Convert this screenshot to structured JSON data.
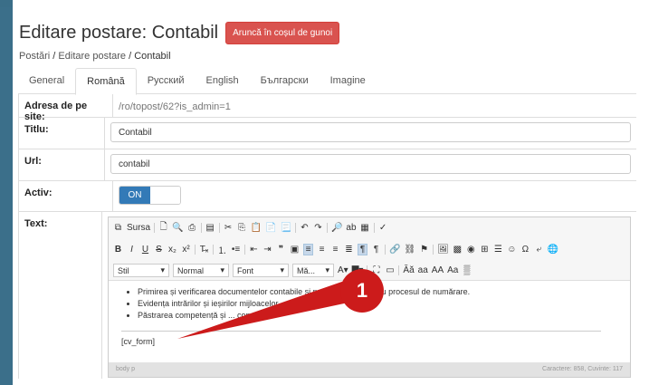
{
  "header": {
    "title": "Editare postare: Contabil",
    "trash_label": "Aruncă în coșul de gunoi"
  },
  "breadcrumb": {
    "root": "Postări",
    "sep1": " / ",
    "mid": "Editare postare",
    "sep2": " / ",
    "current": "Contabil"
  },
  "tabs": [
    "General",
    "Română",
    "Русский",
    "English",
    "Български",
    "Imagine"
  ],
  "form": {
    "site_address_label": "Adresa de pe site:",
    "site_address_value": "/ro/topost/62?is_admin=1",
    "title_label": "Titlu:",
    "title_value": "Contabil",
    "url_label": "Url:",
    "url_value": "contabil",
    "active_label": "Activ:",
    "active_value": "ON",
    "text_label": "Text:"
  },
  "editor": {
    "source_label": "Sursa",
    "style_dd": "Stil",
    "format_dd": "Normal",
    "font_dd": "Font",
    "size_dd": "Mă...",
    "bullets": [
      "Primirea și verificarea documentelor contabile și pregătirea lor pentru procesul de numărare.",
      "Evidența intrărilor și ieșirilor mijloacelor ...",
      "Păstrarea competență și ... con..."
    ],
    "shortcode": "[cv_form]",
    "status_path": "body   p",
    "status_counts": "Caractere: 858, Cuvinte: 117"
  },
  "annotation": {
    "number": "1",
    "color": "#cc1b1b"
  }
}
